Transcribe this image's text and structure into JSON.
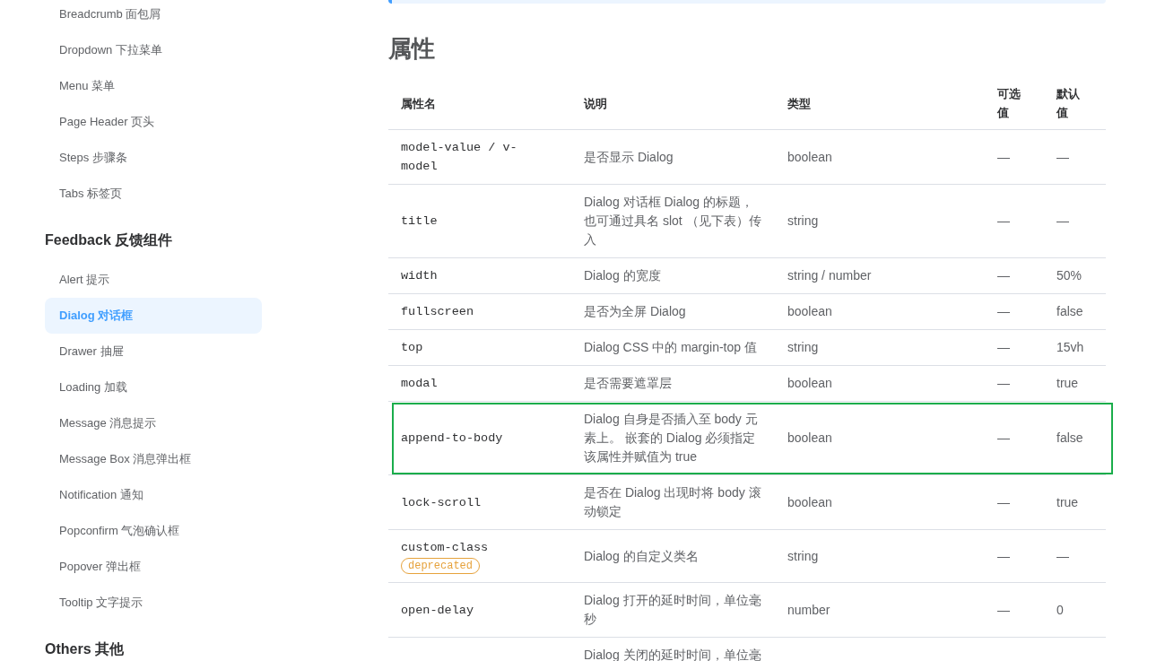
{
  "sidebar": {
    "groups": [
      {
        "items": [
          {
            "label": "Breadcrumb 面包屑",
            "selected": false
          },
          {
            "label": "Dropdown 下拉菜单",
            "selected": false
          },
          {
            "label": "Menu 菜单",
            "selected": false
          },
          {
            "label": "Page Header 页头",
            "selected": false
          },
          {
            "label": "Steps 步骤条",
            "selected": false
          },
          {
            "label": "Tabs 标签页",
            "selected": false
          }
        ]
      },
      {
        "title": "Feedback 反馈组件",
        "items": [
          {
            "label": "Alert 提示",
            "selected": false
          },
          {
            "label": "Dialog 对话框",
            "selected": true
          },
          {
            "label": "Drawer 抽屉",
            "selected": false
          },
          {
            "label": "Loading 加载",
            "selected": false
          },
          {
            "label": "Message 消息提示",
            "selected": false
          },
          {
            "label": "Message Box 消息弹出框",
            "selected": false
          },
          {
            "label": "Notification 通知",
            "selected": false
          },
          {
            "label": "Popconfirm 气泡确认框",
            "selected": false
          },
          {
            "label": "Popover 弹出框",
            "selected": false
          },
          {
            "label": "Tooltip 文字提示",
            "selected": false
          }
        ]
      },
      {
        "title": "Others 其他"
      }
    ]
  },
  "section": {
    "title": "属性",
    "table": {
      "columns": [
        "属性名",
        "说明",
        "类型",
        "可选值",
        "默认值"
      ],
      "rows": [
        {
          "name": "model-value / v-model",
          "description": "是否显示 Dialog",
          "type": "boolean",
          "options": "—",
          "default": "—",
          "highlighted": false
        },
        {
          "name": "title",
          "description": "Dialog 对话框 Dialog 的标题，也可通过具名 slot （见下表）传入",
          "type": "string",
          "options": "—",
          "default": "—",
          "highlighted": false
        },
        {
          "name": "width",
          "description": "Dialog 的宽度",
          "type": "string / number",
          "options": "—",
          "default": "50%",
          "highlighted": false
        },
        {
          "name": "fullscreen",
          "description": "是否为全屏 Dialog",
          "type": "boolean",
          "options": "—",
          "default": "false",
          "highlighted": false
        },
        {
          "name": "top",
          "description": "Dialog CSS 中的 margin-top 值",
          "type": "string",
          "options": "—",
          "default": "15vh",
          "highlighted": false
        },
        {
          "name": "modal",
          "description": "是否需要遮罩层",
          "type": "boolean",
          "options": "—",
          "default": "true",
          "highlighted": false
        },
        {
          "name": "append-to-body",
          "description": "Dialog 自身是否插入至 body 元素上。 嵌套的 Dialog 必须指定该属性并赋值为 true",
          "type": "boolean",
          "options": "—",
          "default": "false",
          "highlighted": true
        },
        {
          "name": "lock-scroll",
          "description": "是否在 Dialog 出现时将 body 滚动锁定",
          "type": "boolean",
          "options": "—",
          "default": "true",
          "highlighted": false
        },
        {
          "name": "custom-class",
          "badge": "deprecated",
          "description": "Dialog 的自定义类名",
          "type": "string",
          "options": "—",
          "default": "—",
          "highlighted": false
        },
        {
          "name": "open-delay",
          "description": "Dialog 打开的延时时间，单位毫秒",
          "type": "number",
          "options": "—",
          "default": "0",
          "highlighted": false
        },
        {
          "description": "Dialog 关闭的延时时间，单位毫",
          "highlighted": false
        }
      ]
    }
  }
}
